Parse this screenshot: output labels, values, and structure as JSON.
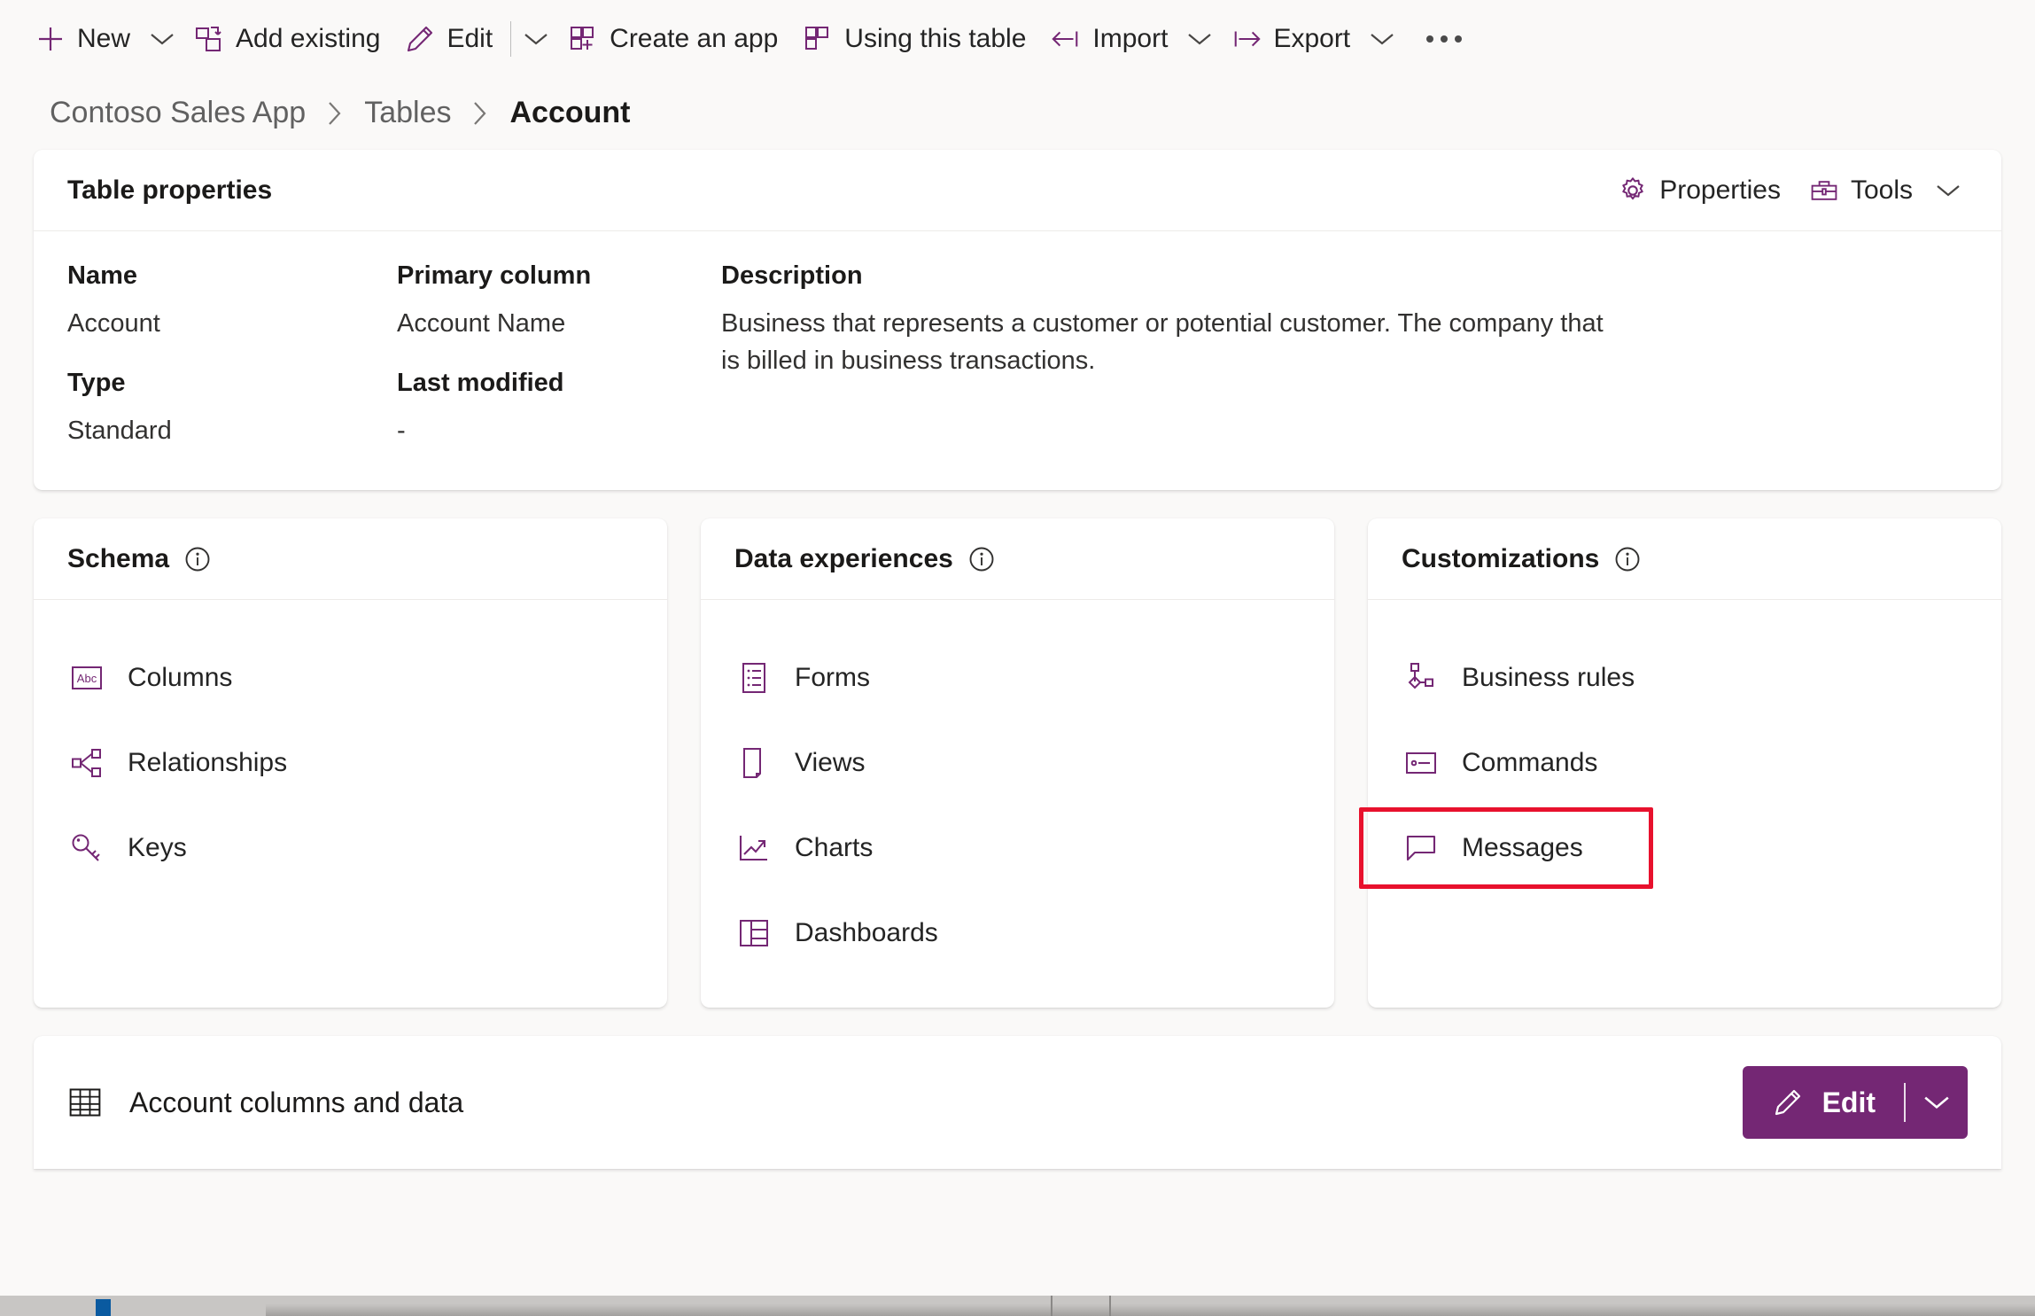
{
  "commandbar": {
    "items": [
      {
        "label": "New",
        "icon": "add-icon",
        "has_caret": true
      },
      {
        "label": "Add existing",
        "icon": "add-existing-icon",
        "has_caret": false
      },
      {
        "label": "Edit",
        "icon": "pencil-icon",
        "has_caret": true,
        "divider_before_caret": true
      },
      {
        "label": "Create an app",
        "icon": "create-app-icon",
        "has_caret": false
      },
      {
        "label": "Using this table",
        "icon": "using-this-table-icon",
        "has_caret": false
      },
      {
        "label": "Import",
        "icon": "import-icon",
        "has_caret": true
      },
      {
        "label": "Export",
        "icon": "export-icon",
        "has_caret": true
      }
    ],
    "overflow": "…"
  },
  "breadcrumb": {
    "items": [
      {
        "label": "Contoso Sales App",
        "current": false
      },
      {
        "label": "Tables",
        "current": false
      },
      {
        "label": "Account",
        "current": true
      }
    ]
  },
  "table_properties": {
    "title": "Table properties",
    "actions": [
      {
        "label": "Properties",
        "icon": "gear-icon",
        "has_caret": false
      },
      {
        "label": "Tools",
        "icon": "toolbox-icon",
        "has_caret": true
      }
    ],
    "fields": {
      "name_label": "Name",
      "name_value": "Account",
      "type_label": "Type",
      "type_value": "Standard",
      "primary_column_label": "Primary column",
      "primary_column_value": "Account Name",
      "last_modified_label": "Last modified",
      "last_modified_value": "-",
      "description_label": "Description",
      "description_value": "Business that represents a customer or potential customer. The company that is billed in business transactions."
    }
  },
  "cards": [
    {
      "title": "Schema",
      "info_icon": "info-icon",
      "links": [
        {
          "label": "Columns",
          "icon": "abc-columns-icon",
          "highlighted": false
        },
        {
          "label": "Relationships",
          "icon": "relationships-icon",
          "highlighted": false
        },
        {
          "label": "Keys",
          "icon": "key-icon",
          "highlighted": false
        }
      ]
    },
    {
      "title": "Data experiences",
      "info_icon": "info-icon",
      "links": [
        {
          "label": "Forms",
          "icon": "forms-icon",
          "highlighted": false
        },
        {
          "label": "Views",
          "icon": "views-icon",
          "highlighted": false
        },
        {
          "label": "Charts",
          "icon": "charts-icon",
          "highlighted": false
        },
        {
          "label": "Dashboards",
          "icon": "dashboards-icon",
          "highlighted": false
        }
      ]
    },
    {
      "title": "Customizations",
      "info_icon": "info-icon",
      "links": [
        {
          "label": "Business rules",
          "icon": "business-rules-icon",
          "highlighted": false
        },
        {
          "label": "Commands",
          "icon": "commands-icon",
          "highlighted": false
        },
        {
          "label": "Messages",
          "icon": "messages-icon",
          "highlighted": true
        }
      ]
    }
  ],
  "bottom": {
    "title": "Account columns and data",
    "icon": "grid-table-icon",
    "edit_label": "Edit"
  },
  "colors": {
    "accent_purple": "#742774",
    "highlight_red": "#e8112d",
    "page_background": "#faf9f8",
    "card_background": "#ffffff",
    "text_primary": "#1b1a19",
    "text_secondary": "#616161"
  }
}
